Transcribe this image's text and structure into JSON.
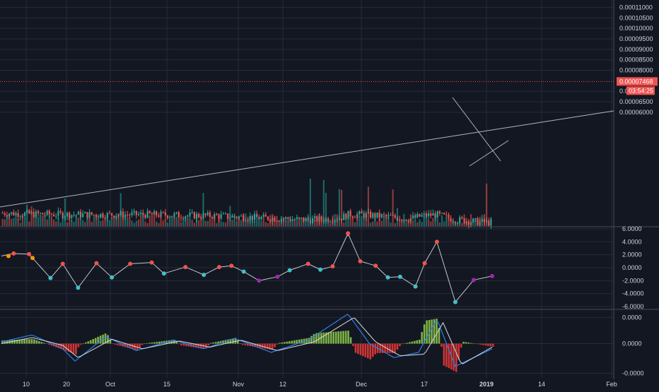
{
  "colors": {
    "background": "#131722",
    "grid": "#262b38",
    "axis_text": "#d1d4dc",
    "up": "#26a69a",
    "down": "#ef5350",
    "trendline": "#b2b5be",
    "price_tag": "#ef5350",
    "osc_line": "#c3c5cc",
    "macd_line": "#2f7fe6",
    "signal_line": "#d9dbe1",
    "hist_up": "#8bc34a",
    "hist_down": "#e53935",
    "marker_red": "#ef5350",
    "marker_cyan": "#3fc1c9",
    "marker_orange": "#ff9800",
    "marker_purple": "#9c27b0"
  },
  "x_axis": {
    "labels": [
      "10",
      "20",
      "Oct",
      "15",
      "Nov",
      "12",
      "Dec",
      "17",
      "2019",
      "14",
      "Feb"
    ]
  },
  "price_axis": {
    "ticks": [
      "0.00011000",
      "0.00010500",
      "0.00010000",
      "0.00009500",
      "0.00009000",
      "0.00008500",
      "0.00008000",
      "0.00007000",
      "0.00006500",
      "0.00006000"
    ],
    "last_price": "0.00007468",
    "countdown": "03:54:25"
  },
  "oscillator_axis": {
    "ticks": [
      "6.0000",
      "4.0000",
      "2.0000",
      "0.0000",
      "-2.0000",
      "-4.0000",
      "-6.0000"
    ]
  },
  "macd_axis": {
    "ticks": [
      "0.0000",
      "0.0000",
      "-0.0000"
    ]
  },
  "chart_data": [
    {
      "type": "candlestick",
      "x_labels": [
        "10",
        "20",
        "Oct",
        "15",
        "Nov",
        "12",
        "Dec",
        "17",
        "2019",
        "14",
        "Feb"
      ],
      "y_range": [
        5.8e-06,
        0.0001135
      ],
      "close_path": [
        [
          0,
          1.2e-05
        ],
        [
          0.04,
          1.16e-05
        ],
        [
          0.11,
          1.13e-05
        ],
        [
          0.17,
          1.12e-05
        ],
        [
          0.24,
          1.13e-05
        ],
        [
          0.3,
          1.09e-05
        ],
        [
          0.35,
          1.06e-05
        ],
        [
          0.4,
          1e-05
        ],
        [
          0.46,
          9.3e-06
        ],
        [
          0.5,
          8.7e-06
        ],
        [
          0.53,
          9.1e-06
        ],
        [
          0.555,
          9.8e-06
        ],
        [
          0.565,
          1.13e-05
        ],
        [
          0.59,
          1.12e-05
        ],
        [
          0.63,
          1.03e-05
        ],
        [
          0.665,
          9.2e-06
        ],
        [
          0.69,
          1.08e-05
        ],
        [
          0.71,
          1.13e-05
        ],
        [
          0.725,
          1.02e-05
        ],
        [
          0.74,
          8.9e-06
        ],
        [
          0.76,
          8.2e-06
        ],
        [
          0.785,
          7.6e-06
        ],
        [
          0.8,
          7.5e-06
        ]
      ],
      "annotations": {
        "ascending_trendline": [
          [
            6.1e-06,
            8.7e-06
          ]
        ],
        "last_price": "0.00007468"
      }
    },
    {
      "type": "line",
      "name": "",
      "y_range": [
        -6,
        6
      ],
      "path": [
        [
          0,
          1.8
        ],
        [
          0.02,
          2.2
        ],
        [
          0.045,
          2.1
        ],
        [
          0.08,
          -1.6
        ],
        [
          0.1,
          0.6
        ],
        [
          0.125,
          -3.1
        ],
        [
          0.155,
          0.7
        ],
        [
          0.18,
          -1.5
        ],
        [
          0.21,
          0.6
        ],
        [
          0.245,
          0.8
        ],
        [
          0.265,
          -0.9
        ],
        [
          0.3,
          0.1
        ],
        [
          0.33,
          -1.1
        ],
        [
          0.355,
          0.1
        ],
        [
          0.375,
          0.3
        ],
        [
          0.395,
          -0.6
        ],
        [
          0.42,
          -2.0
        ],
        [
          0.45,
          -1.4
        ],
        [
          0.47,
          -0.4
        ],
        [
          0.5,
          0.6
        ],
        [
          0.52,
          -0.3
        ],
        [
          0.54,
          0.2
        ],
        [
          0.565,
          5.3
        ],
        [
          0.585,
          1.0
        ],
        [
          0.61,
          0.3
        ],
        [
          0.63,
          -1.5
        ],
        [
          0.65,
          -1.4
        ],
        [
          0.675,
          -2.9
        ],
        [
          0.69,
          0.7
        ],
        [
          0.71,
          4.0
        ],
        [
          0.74,
          -5.3
        ],
        [
          0.77,
          -1.9
        ],
        [
          0.8,
          -1.3
        ]
      ]
    },
    {
      "type": "line+histogram",
      "series": [
        {
          "path": [
            [
              0,
              0.1
            ],
            [
              0.05,
              0.5
            ],
            [
              0.1,
              -0.3
            ],
            [
              0.12,
              -1.0
            ],
            [
              0.17,
              0.4
            ],
            [
              0.22,
              -0.4
            ],
            [
              0.28,
              0.2
            ],
            [
              0.33,
              -0.3
            ],
            [
              0.38,
              0.3
            ],
            [
              0.44,
              -0.5
            ],
            [
              0.5,
              0.2
            ],
            [
              0.565,
              1.7
            ],
            [
              0.6,
              0.0
            ],
            [
              0.64,
              -0.8
            ],
            [
              0.68,
              -0.5
            ],
            [
              0.71,
              1.4
            ],
            [
              0.74,
              -1.3
            ],
            [
              0.8,
              -0.3
            ]
          ]
        },
        {
          "path": [
            [
              0,
              0.0
            ],
            [
              0.05,
              0.35
            ],
            [
              0.1,
              -0.1
            ],
            [
              0.125,
              -0.8
            ],
            [
              0.18,
              0.25
            ],
            [
              0.23,
              -0.3
            ],
            [
              0.29,
              0.15
            ],
            [
              0.34,
              -0.2
            ],
            [
              0.39,
              0.2
            ],
            [
              0.45,
              -0.4
            ],
            [
              0.51,
              0.1
            ],
            [
              0.575,
              1.5
            ],
            [
              0.61,
              0.1
            ],
            [
              0.65,
              -0.7
            ],
            [
              0.69,
              -0.6
            ],
            [
              0.72,
              1.2
            ],
            [
              0.75,
              -1.2
            ],
            [
              0.8,
              -0.2
            ]
          ]
        }
      ],
      "y_range": [
        -1.8,
        1.8
      ]
    }
  ]
}
